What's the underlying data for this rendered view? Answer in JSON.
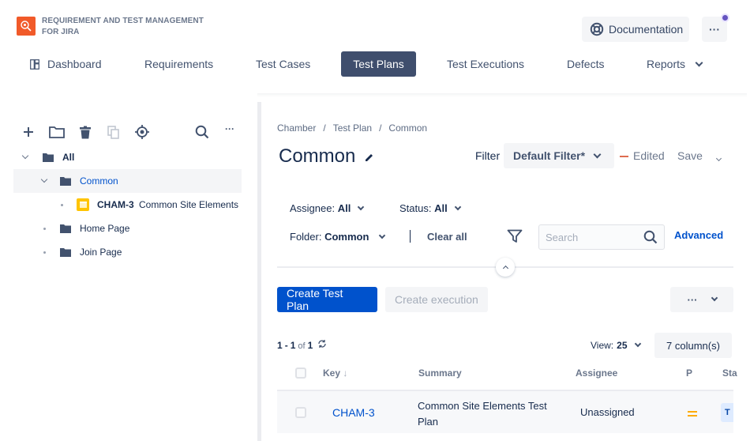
{
  "header": {
    "app_title_line1": "REQUIREMENT AND TEST MANAGEMENT",
    "app_title_line2": "FOR JIRA",
    "brand_color": "#f15a29",
    "documentation_label": "Documentation",
    "more_label": "···"
  },
  "nav": {
    "items": [
      {
        "label": "Dashboard",
        "icon": "dashboard-icon",
        "active": false
      },
      {
        "label": "Requirements",
        "active": false
      },
      {
        "label": "Test Cases",
        "active": false
      },
      {
        "label": "Test Plans",
        "active": true
      },
      {
        "label": "Test Executions",
        "active": false
      },
      {
        "label": "Defects",
        "active": false
      },
      {
        "label": "Reports",
        "dropdown": true,
        "active": false
      }
    ]
  },
  "sidebar": {
    "toolbar": [
      "add-icon",
      "folder-icon",
      "trash-icon",
      "copy-icon",
      "target-icon",
      "search-icon",
      "more-icon"
    ],
    "tree": [
      {
        "label": "All",
        "level": 0,
        "expanded": true
      },
      {
        "label": "Common",
        "level": 1,
        "expanded": true,
        "selected": true
      },
      {
        "key": "CHAM-3",
        "label": "Common Site Elements",
        "level": 2,
        "type": "test-plan"
      },
      {
        "label": "Home Page",
        "level": 1
      },
      {
        "label": "Join Page",
        "level": 1
      }
    ]
  },
  "main": {
    "breadcrumb": [
      "Chamber",
      "Test Plan",
      "Common"
    ],
    "breadcrumb_sep": "/",
    "title": "Common",
    "filter": {
      "label": "Filter",
      "value": "Default Filter*",
      "edited_label": "Edited",
      "save_label": "Save"
    },
    "chips": {
      "assignee_label": "Assignee:",
      "assignee_value": "All",
      "status_label": "Status:",
      "status_value": "All",
      "folder_label": "Folder:",
      "folder_value": "Common",
      "clear_all": "Clear all"
    },
    "search_placeholder": "Search",
    "advanced_label": "Advanced",
    "create_test_plan": "Create Test Plan",
    "create_execution": "Create execution",
    "actions_more": "···",
    "pagination": {
      "from": "1",
      "dash": "-",
      "to": "1",
      "of": "of",
      "total": "1"
    },
    "view_label": "View:",
    "view_value": "25",
    "columns_label": "7 column(s)",
    "table": {
      "headers": [
        "Key",
        "Summary",
        "Assignee",
        "P",
        "Sta"
      ],
      "sort_indicator": "↓",
      "rows": [
        {
          "key": "CHAM-3",
          "summary_line1": "Common Site Elements Test",
          "summary_line2": "Plan",
          "assignee": "Unassigned",
          "priority": "medium",
          "priority_color": "#ffab00",
          "status": "T"
        }
      ]
    }
  }
}
